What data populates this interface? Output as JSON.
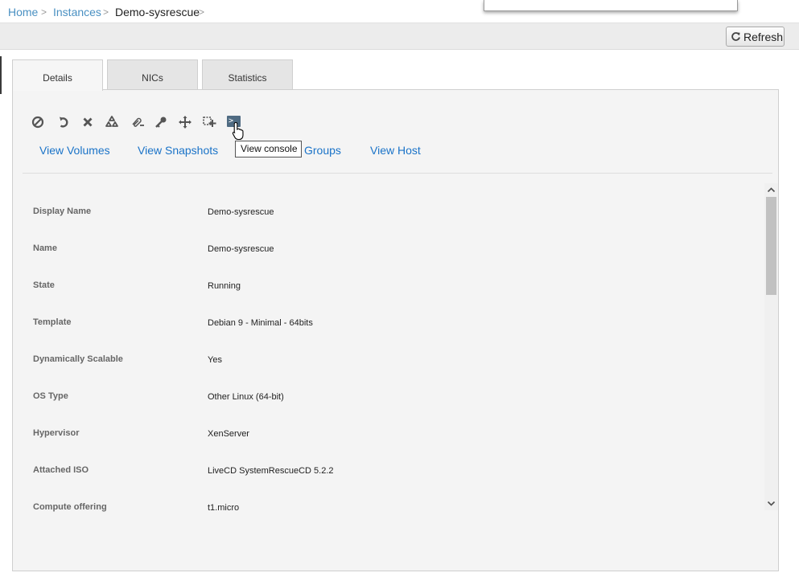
{
  "breadcrumb": {
    "home": "Home",
    "instances": "Instances",
    "current": "Demo-sysrescue",
    "separator": ">"
  },
  "toolbar": {
    "refresh_label": "Refresh",
    "refresh_icon": "refresh-icon"
  },
  "tabs": [
    {
      "label": "Details",
      "active": true
    },
    {
      "label": "NICs",
      "active": false
    },
    {
      "label": "Statistics",
      "active": false
    }
  ],
  "actions": [
    {
      "name": "stop-icon"
    },
    {
      "name": "reboot-icon"
    },
    {
      "name": "destroy-icon"
    },
    {
      "name": "reinstall-icon"
    },
    {
      "name": "detach-iso-icon"
    },
    {
      "name": "reset-password-icon"
    },
    {
      "name": "migrate-icon"
    },
    {
      "name": "scale-icon"
    },
    {
      "name": "view-console-icon",
      "glyph": ">_"
    }
  ],
  "tooltip": "View console",
  "links": {
    "volumes": "View Volumes",
    "snapshots": "View Snapshots",
    "groups": "Groups",
    "host": "View Host"
  },
  "details": [
    {
      "label": "Display Name",
      "value": "Demo-sysrescue"
    },
    {
      "label": "Name",
      "value": "Demo-sysrescue"
    },
    {
      "label": "State",
      "value": "Running"
    },
    {
      "label": "Template",
      "value": "Debian 9 - Minimal - 64bits"
    },
    {
      "label": "Dynamically Scalable",
      "value": "Yes"
    },
    {
      "label": "OS Type",
      "value": "Other Linux (64-bit)"
    },
    {
      "label": "Hypervisor",
      "value": "XenServer"
    },
    {
      "label": "Attached ISO",
      "value": "LiveCD SystemRescueCD 5.2.2"
    },
    {
      "label": "Compute offering",
      "value": "t1.micro"
    }
  ],
  "colors": {
    "link": "#1a73c8",
    "breadcrumb_link": "#4a90c2",
    "console_icon": "#4f6b82",
    "panel_bg": "#f4f4f4"
  }
}
